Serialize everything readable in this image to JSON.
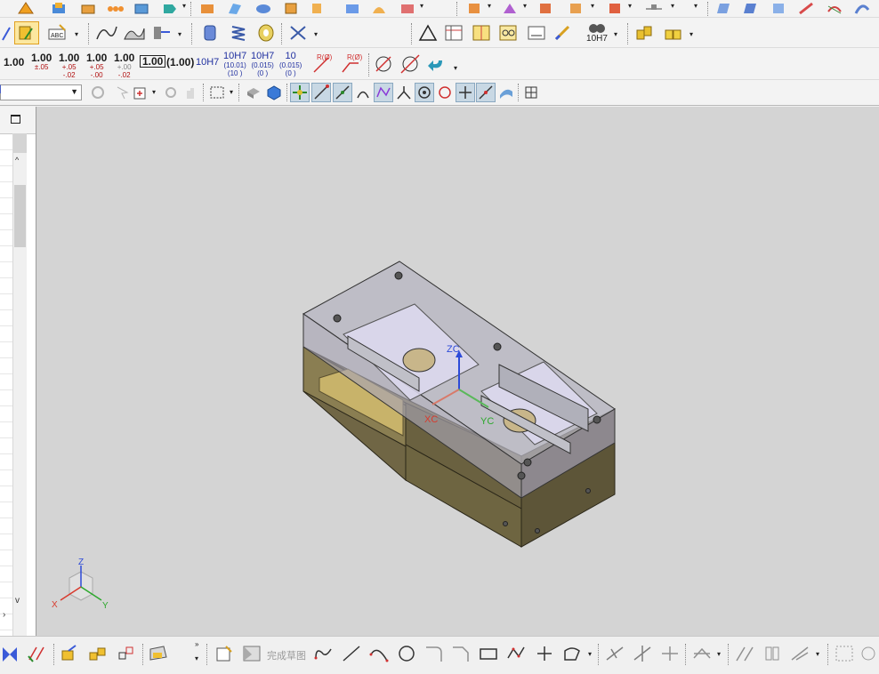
{
  "colors": {
    "viewport_bg": "#d4d4d4",
    "toolbar_bg": "#f3f3f3",
    "part_body": "#6e6540",
    "part_glass": "#b9b7c4",
    "axis_z": "#2d4bd8",
    "axis_x": "#d83a2d",
    "axis_y": "#2da82d"
  },
  "pmi_toolbar": {
    "tol_1": {
      "main": "1.00"
    },
    "tol_2": {
      "main": "1.00",
      "sub": "±.05"
    },
    "tol_3": {
      "main": "1.00",
      "upper": "+.05",
      "lower": "-.02"
    },
    "tol_4": {
      "main": "1.00",
      "upper": "+.05",
      "lower": "-.00"
    },
    "tol_5": {
      "main": "1.00",
      "upper": "+.00",
      "lower": "-.02"
    },
    "tol_6": {
      "main": "1.00"
    },
    "tol_7": {
      "main": "(1.00)"
    },
    "fit_1": {
      "main": "10H7"
    },
    "fit_2": {
      "main": "10H7",
      "sub1": "(10.01)",
      "sub2": "(10   )"
    },
    "fit_3": {
      "main": "10H7",
      "sub1": "(0.015)",
      "sub2": "(0      )"
    },
    "fit_4": {
      "main": "10",
      "sub1": "(0.015)",
      "sub2": "(0      )"
    },
    "radius_1": "R(Ø)",
    "radius_2": "R(Ø)"
  },
  "fit_dropdown": {
    "value": "10H7"
  },
  "viewport": {
    "axis_labels": {
      "zc": "ZC",
      "xc": "XC",
      "yc": "YC"
    },
    "triad": {
      "z": "Z",
      "x": "X",
      "y": "Y"
    }
  },
  "bottom_toolbar": {
    "finish_sketch_label": "完成草图"
  }
}
